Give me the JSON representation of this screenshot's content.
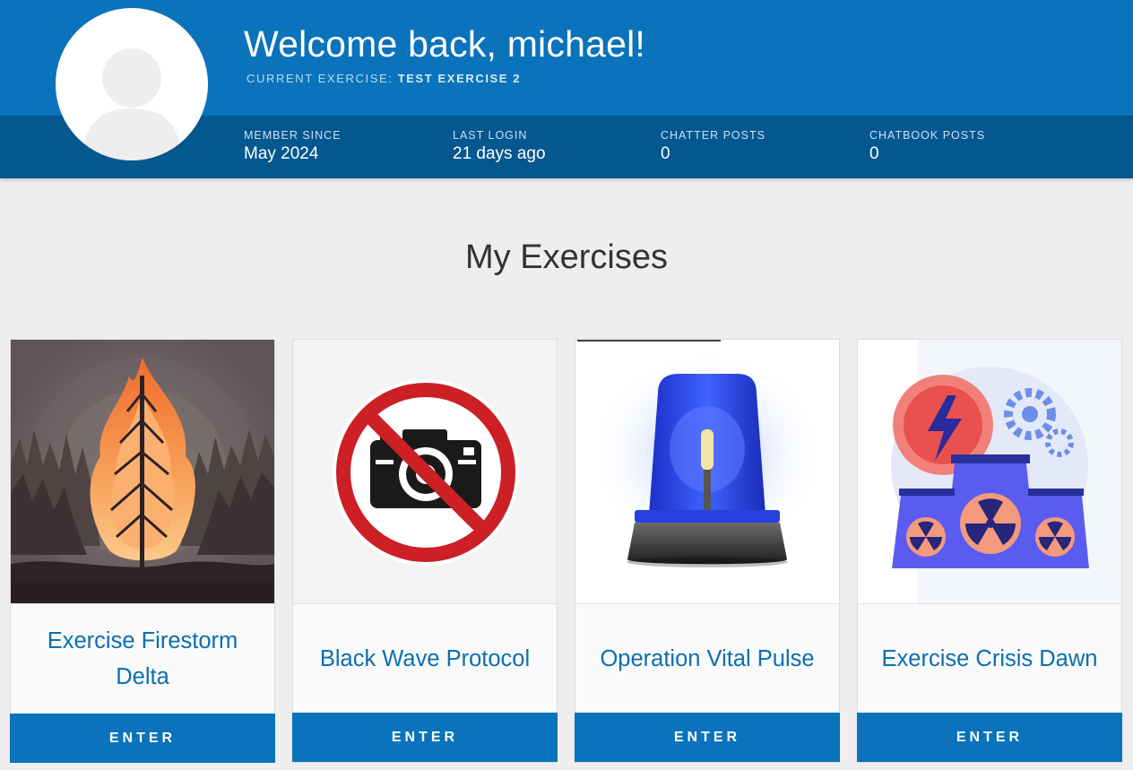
{
  "header": {
    "welcome": "Welcome back, michael!",
    "current_exercise_label": "CURRENT EXERCISE:",
    "current_exercise_name": "TEST EXERCISE 2"
  },
  "stats": [
    {
      "label": "MEMBER SINCE",
      "value": "May 2024"
    },
    {
      "label": "LAST LOGIN",
      "value": "21 days ago"
    },
    {
      "label": "CHATTER POSTS",
      "value": "0"
    },
    {
      "label": "CHATBOOK POSTS",
      "value": "0"
    }
  ],
  "section_title": "My Exercises",
  "exercises": [
    {
      "title": "Exercise Firestorm Delta",
      "button": "ENTER",
      "icon": "burning-tree-image"
    },
    {
      "title": "Black Wave Protocol",
      "button": "ENTER",
      "icon": "no-camera-image"
    },
    {
      "title": "Operation Vital Pulse",
      "button": "ENTER",
      "icon": "emergency-siren-image"
    },
    {
      "title": "Exercise Crisis Dawn",
      "button": "ENTER",
      "icon": "nuclear-plant-image"
    }
  ],
  "colors": {
    "primary": "#0a73bb",
    "header_bar": "#05578f",
    "background": "#eeeeee",
    "title_text": "#0a6fb0"
  }
}
